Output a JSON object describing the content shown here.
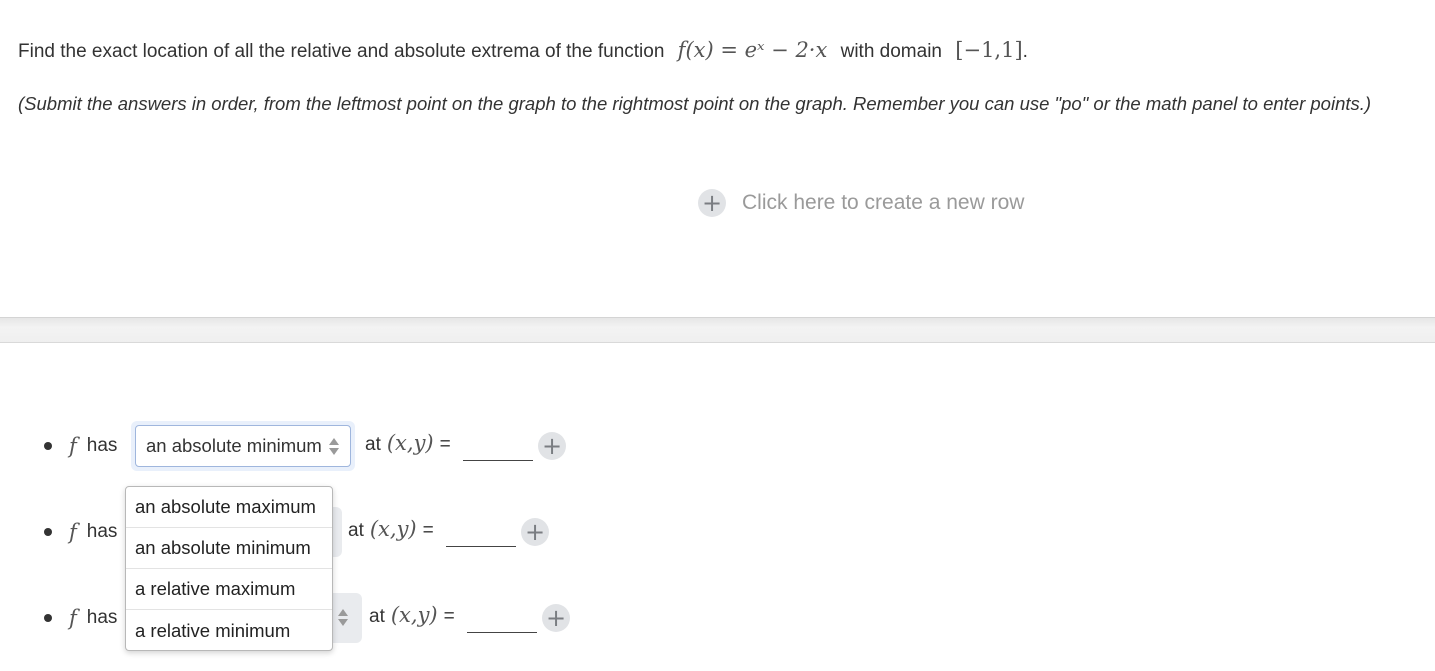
{
  "question": {
    "text_before": "Find the exact location of all the relative and absolute extrema of the function",
    "function_math": "f(x) = eˣ − 2·x",
    "text_middle": "with domain",
    "domain_math": "[−1,1]",
    "text_end": "."
  },
  "instructions": "(Submit the answers in order, from the leftmost point on the graph to the rightmost point on the graph. Remember you can use \"po\" or the math panel to enter points.)",
  "new_row": {
    "label": "Click here to create a new row"
  },
  "rows": [
    {
      "f": "f",
      "has": "has",
      "selected": "an absolute minimum",
      "at": "at",
      "point": "(x,y)",
      "eq": "=",
      "value": ""
    },
    {
      "f": "f",
      "has": "has",
      "selected": "",
      "at": "at",
      "point": "(x,y)",
      "eq": "=",
      "value": ""
    },
    {
      "f": "f",
      "has": "has",
      "selected": "",
      "at": "at",
      "point": "(x,y)",
      "eq": "=",
      "value": ""
    }
  ],
  "dropdown": {
    "options": [
      "an absolute maximum",
      "an absolute minimum",
      "a relative maximum",
      "a relative minimum"
    ]
  },
  "icons": {
    "plus": "+"
  },
  "colors": {
    "select_border": "#9fb6dd",
    "plus_bg": "#e1e3e6",
    "hint_text": "#9a9a9a"
  }
}
